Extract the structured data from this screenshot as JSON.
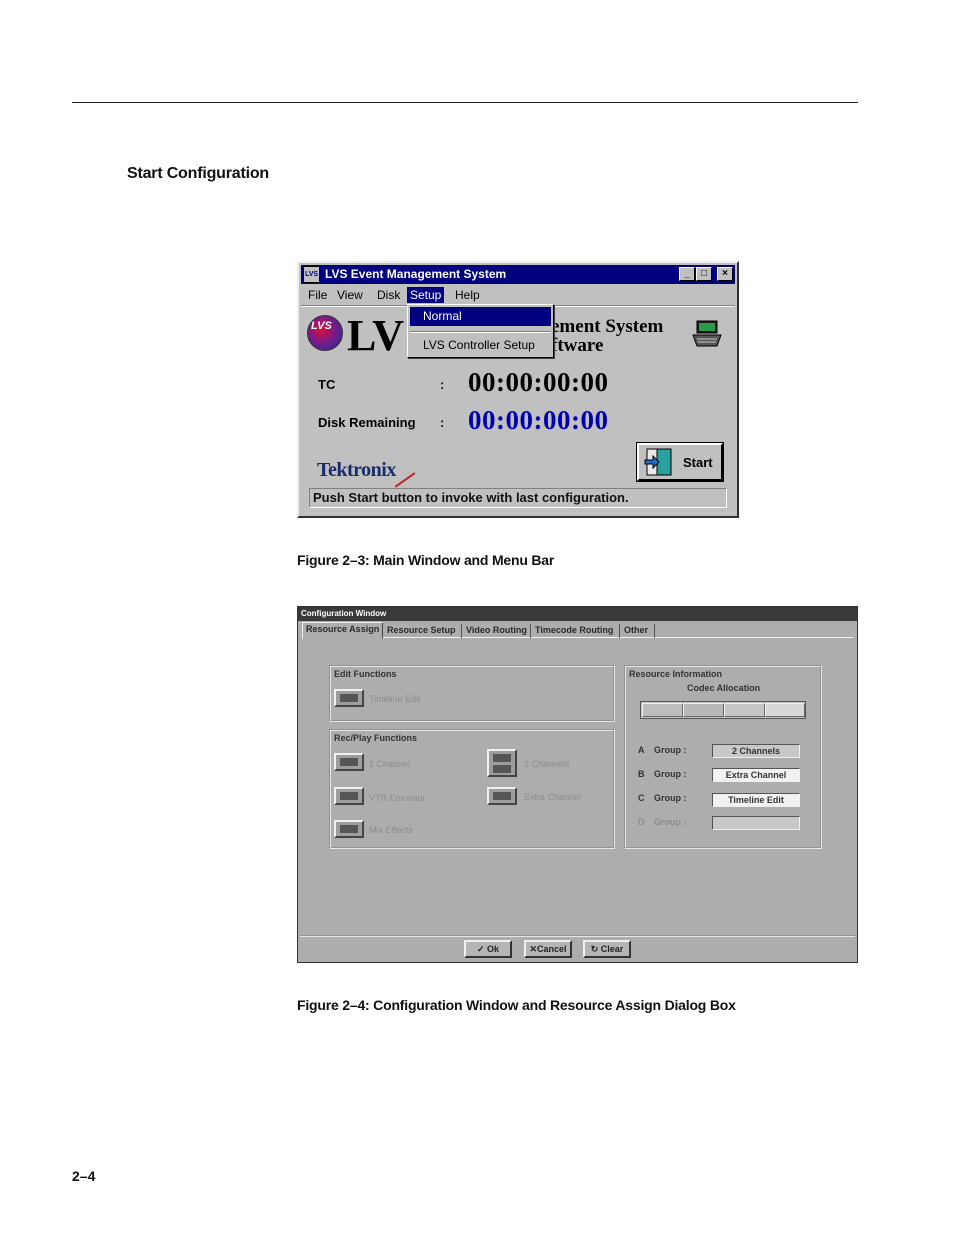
{
  "page": {
    "section_heading": "Start Configuration",
    "figure1_caption": "Figure 2–3: Main Window and Menu Bar",
    "figure2_caption": "Figure 2–4: Configuration Window and Resource Assign Dialog Box",
    "page_number": "2–4"
  },
  "main_window": {
    "title": "LVS Event Management System",
    "icon_text": "LVS",
    "controls": {
      "minimize": "_",
      "maximize": "□",
      "close": "×"
    },
    "menu": [
      "File",
      "View",
      "Disk",
      "Setup",
      "Help"
    ],
    "open_menu": "Setup",
    "setup_menu_items": [
      "Normal",
      "LVS Controller Setup"
    ],
    "logo_title": "LV",
    "subtitle_line1": "ement System",
    "subtitle_line2": "ftware",
    "tc_label": "TC",
    "tc_colon": ":",
    "tc_value": "00:00:00:00",
    "disk_label": "Disk Remaining",
    "disk_colon": ":",
    "disk_value": "00:00:00:00",
    "brand": "Tektronix",
    "start_button": "Start",
    "status_text": "Push Start button to invoke with last configuration."
  },
  "config_window": {
    "title": "Configuration Window",
    "tabs": [
      "Resource Assign",
      "Resource Setup",
      "Video Routing",
      "Timecode Routing",
      "Other"
    ],
    "active_tab": "Resource Assign",
    "edit_functions": {
      "title": "Edit Functions",
      "options": [
        "Timeline Edit"
      ]
    },
    "rec_play_functions": {
      "title": "Rec/Play Functions",
      "options": [
        "1 Channel",
        "2 Channels",
        "VTR Emulator",
        "Extra Channel",
        "Mix Effects"
      ]
    },
    "resource_information": {
      "title": "Resource Information",
      "codec_label": "Codec Allocation",
      "groups": [
        {
          "letter": "A",
          "label": "Group :",
          "value": "2 Channels"
        },
        {
          "letter": "B",
          "label": "Group :",
          "value": "Extra Channel"
        },
        {
          "letter": "C",
          "label": "Group :",
          "value": "Timeline Edit"
        },
        {
          "letter": "D",
          "label": "Group :",
          "value": ""
        }
      ]
    },
    "buttons": {
      "ok": "Ok",
      "cancel": "Cancel",
      "clear": "Clear"
    }
  }
}
